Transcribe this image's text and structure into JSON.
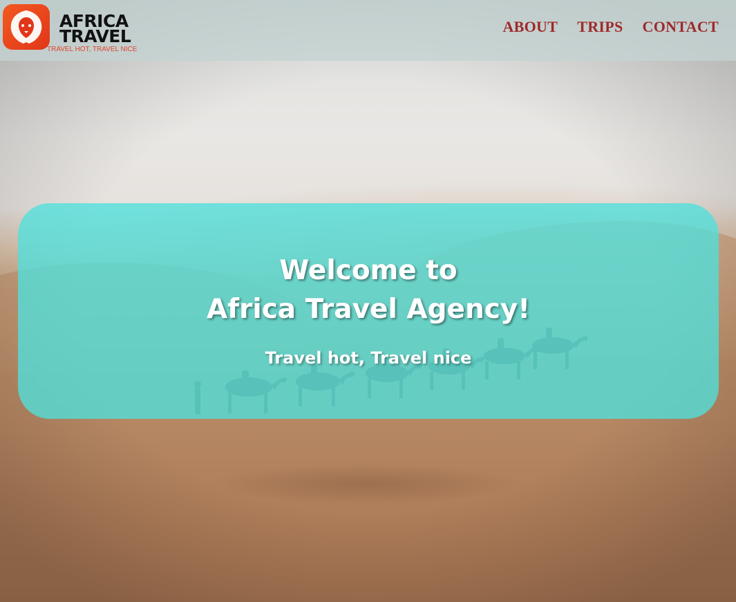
{
  "header": {
    "logo": {
      "line1": "AFRICA",
      "line2": "TRAVEL",
      "tagline": "TRAVEL HOT, TRAVEL NICE",
      "icon": "lion-icon"
    },
    "nav": [
      {
        "label": "ABOUT"
      },
      {
        "label": "TRIPS"
      },
      {
        "label": "CONTACT"
      }
    ]
  },
  "hero": {
    "title_line1": "Welcome to",
    "title_line2": "Africa Travel Agency!",
    "subtitle": "Travel hot, Travel nice"
  },
  "colors": {
    "nav_text": "#9e2a2a",
    "hero_panel": "#50e0dc",
    "logo_badge": "#e1361a",
    "tagline": "#e0432a"
  }
}
